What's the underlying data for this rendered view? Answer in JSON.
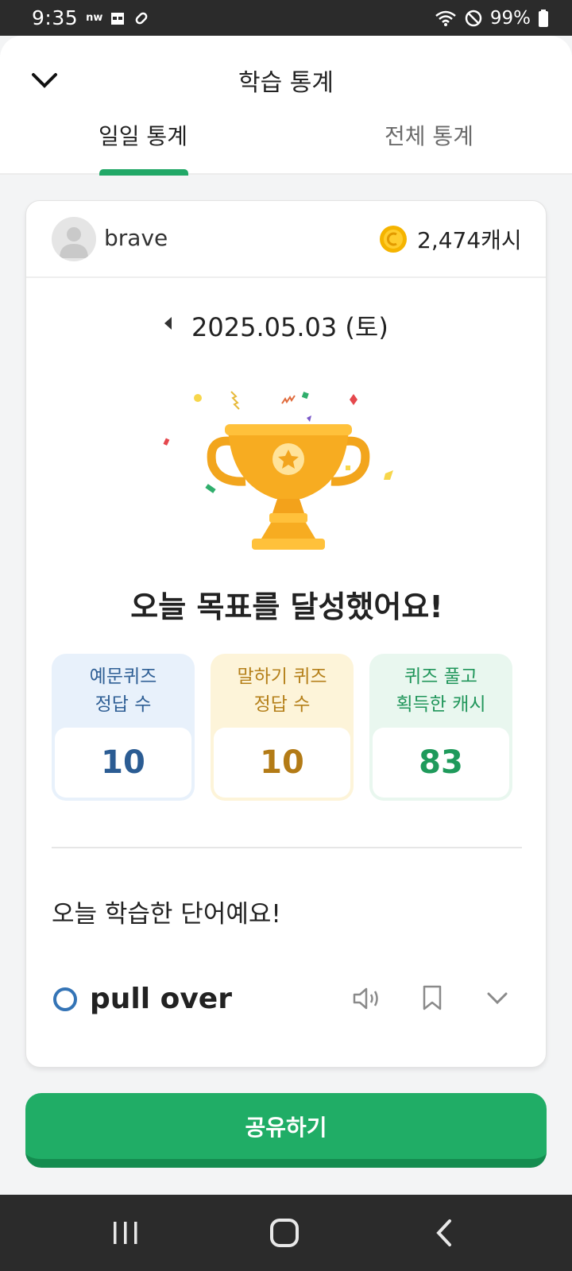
{
  "status_bar": {
    "time": "9:35",
    "icons_left": [
      "nw",
      "calendar-icon",
      "link-icon"
    ],
    "icons_right": [
      "wifi-icon",
      "do-not-disturb-icon"
    ],
    "battery": "99%"
  },
  "header": {
    "title": "학습 통계",
    "tabs": [
      {
        "label": "일일 통계",
        "active": true
      },
      {
        "label": "전체 통계",
        "active": false
      }
    ]
  },
  "card": {
    "user": {
      "name": "brave",
      "cash": "2,474캐시"
    },
    "date": "2025.05.03 (토)",
    "goal_message": "오늘 목표를 달성했어요!",
    "stats": [
      {
        "line1": "예문퀴즈",
        "line2": "정답 수",
        "value": "10"
      },
      {
        "line1": "말하기 퀴즈",
        "line2": "정답 수",
        "value": "10"
      },
      {
        "line1": "퀴즈 풀고",
        "line2": "획득한 캐시",
        "value": "83"
      }
    ],
    "words_title": "오늘 학습한 단어예요!",
    "words": [
      {
        "word": "pull over"
      }
    ]
  },
  "share_button": "공유하기",
  "colors": {
    "accent": "#20ad66",
    "blue": "#2b5c93",
    "amber": "#b37b16",
    "green": "#1f9a5b"
  }
}
